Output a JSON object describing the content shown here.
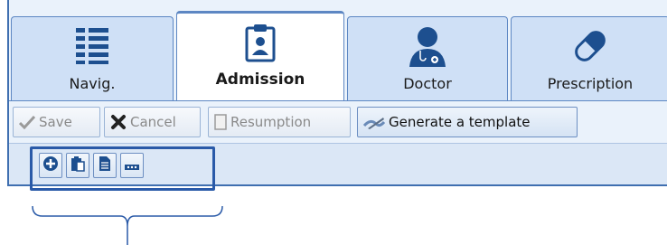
{
  "tabs": [
    {
      "label": "Navig.",
      "icon": "list-icon",
      "active": false
    },
    {
      "label": "Admission",
      "icon": "clipboard-badge-icon",
      "active": true
    },
    {
      "label": "Doctor",
      "icon": "doctor-icon",
      "active": false
    },
    {
      "label": "Prescription",
      "icon": "pill-icon",
      "active": false
    }
  ],
  "toolbar": {
    "save": {
      "label": "Save",
      "icon": "checkmark-icon",
      "enabled": false
    },
    "cancel": {
      "label": "Cancel",
      "icon": "x-icon",
      "enabled": false
    },
    "resumption": {
      "label": "Resumption",
      "icon": "document-icon",
      "enabled": false
    },
    "generate": {
      "label": "Generate a template",
      "icon": "edit-pen-icon",
      "enabled": true
    }
  },
  "subtoolbar": [
    {
      "name": "add-button",
      "icon": "plus-circle-icon"
    },
    {
      "name": "paste-button",
      "icon": "clipboard-icon"
    },
    {
      "name": "document-button",
      "icon": "document-icon"
    },
    {
      "name": "more-button",
      "icon": "ellipsis-icon"
    }
  ],
  "colors": {
    "tab_bg": "#cfe0f6",
    "active_tab_accent": "#f07070",
    "border_blue": "#2a5aa8",
    "icon_blue": "#1d4f8f"
  }
}
